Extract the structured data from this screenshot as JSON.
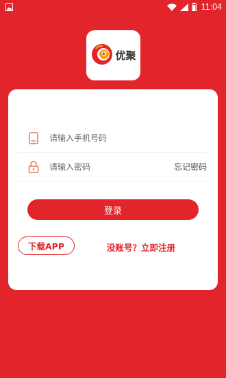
{
  "status_bar": {
    "time": "11:04",
    "icons": [
      "image-notification-icon",
      "wifi-icon",
      "signal-icon",
      "battery-icon"
    ]
  },
  "logo": {
    "text": "优聚",
    "icon": "logo-swirl-icon"
  },
  "login_form": {
    "phone": {
      "icon": "phone-icon",
      "placeholder": "请输入手机号码",
      "value": ""
    },
    "password": {
      "icon": "lock-icon",
      "placeholder": "请输入密码",
      "value": "",
      "forgot_label": "忘记密码"
    },
    "login_label": "登录",
    "download_label": "下载APP",
    "register_label": "没账号？立即注册"
  },
  "colors": {
    "brand_red": "#E2242B",
    "card_bg": "#FFFFFF"
  }
}
